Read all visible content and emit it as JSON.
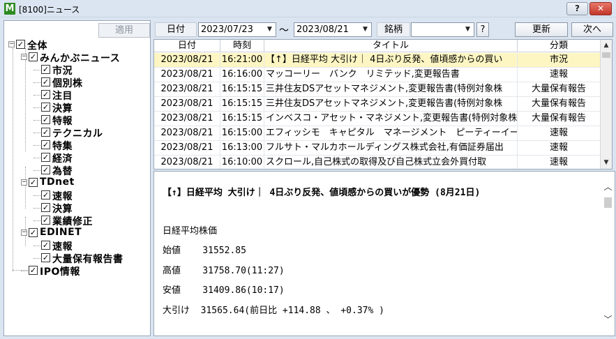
{
  "window": {
    "app_icon_letter": "M",
    "title": "[8100]ニュース",
    "help_label": "?",
    "close_label": "✕"
  },
  "left": {
    "apply_label": "適用",
    "tree": [
      {
        "label": "全体",
        "expander": "−",
        "checked": true
      },
      {
        "label": "みんかぶニュース",
        "expander": "−",
        "checked": true
      },
      {
        "label": "市況",
        "checked": true
      },
      {
        "label": "個別株",
        "checked": true
      },
      {
        "label": "注目",
        "checked": true
      },
      {
        "label": "決算",
        "checked": true
      },
      {
        "label": "特報",
        "checked": true
      },
      {
        "label": "テクニカル",
        "checked": true
      },
      {
        "label": "特集",
        "checked": true
      },
      {
        "label": "経済",
        "checked": true
      },
      {
        "label": "為替",
        "checked": true
      },
      {
        "label": "TDnet",
        "expander": "−",
        "checked": true
      },
      {
        "label": "速報",
        "checked": true
      },
      {
        "label": "決算",
        "checked": true
      },
      {
        "label": "業績修正",
        "checked": true
      },
      {
        "label": "EDINET",
        "expander": "−",
        "checked": true
      },
      {
        "label": "速報",
        "checked": true
      },
      {
        "label": "大量保有報告書",
        "checked": true
      },
      {
        "label": "IPO情報",
        "checked": true
      }
    ]
  },
  "toolbar": {
    "date_label": "日付",
    "date_from": "2023/07/23",
    "tilde": "〜",
    "date_to": "2023/08/21",
    "stock_label": "銘柄",
    "stock_value": "",
    "stock_help": "?",
    "refresh_label": "更新",
    "next_label": "次へ",
    "dropdown_glyph": "▼"
  },
  "table": {
    "headers": [
      "日付",
      "時刻",
      "タイトル",
      "分類"
    ],
    "rows": [
      {
        "date": "2023/08/21",
        "time": "16:21:00",
        "title": "【↑】日経平均 大引け｜ 4日ぶり反発、値頃感からの買い",
        "category": "市況",
        "selected": true
      },
      {
        "date": "2023/08/21",
        "time": "16:16:00",
        "title": "マッコーリー　バンク　リミテッド,変更報告書",
        "category": "速報"
      },
      {
        "date": "2023/08/21",
        "time": "16:15:15",
        "title": "三井住友DSアセットマネジメント,変更報告書(特例対象株",
        "category": "大量保有報告"
      },
      {
        "date": "2023/08/21",
        "time": "16:15:15",
        "title": "三井住友DSアセットマネジメント,変更報告書(特例対象株",
        "category": "大量保有報告"
      },
      {
        "date": "2023/08/21",
        "time": "16:15:15",
        "title": "インベスコ・アセット・マネジメント,変更報告書(特例対象株",
        "category": "大量保有報告"
      },
      {
        "date": "2023/08/21",
        "time": "16:15:00",
        "title": "エフィッシモ　キャピタル　マネージメント　ピーティーイー",
        "category": "速報"
      },
      {
        "date": "2023/08/21",
        "time": "16:13:00",
        "title": "フルサト・マルカホールディングス株式会社,有価証券届出",
        "category": "速報"
      },
      {
        "date": "2023/08/21",
        "time": "16:10:00",
        "title": "スクロール,自己株式の取得及び自己株式立会外買付取",
        "category": "速報"
      }
    ]
  },
  "article": {
    "headline": "【↑】日経平均 大引け｜ 4日ぶり反発、値頃感からの買いが優勢 (8月21日)",
    "section_title": "日経平均株価",
    "lines": [
      "始値    31552.85",
      "高値    31758.70(11:27)",
      "安値    31409.86(10:17)",
      "大引け  31565.64(前日比 +114.88 、 +0.37% )"
    ]
  },
  "colors": {
    "selected_row": "#fdf6c3",
    "window_bg": "#dbe5f1",
    "close_button": "#c2372a",
    "app_icon": "#2e8b22"
  }
}
